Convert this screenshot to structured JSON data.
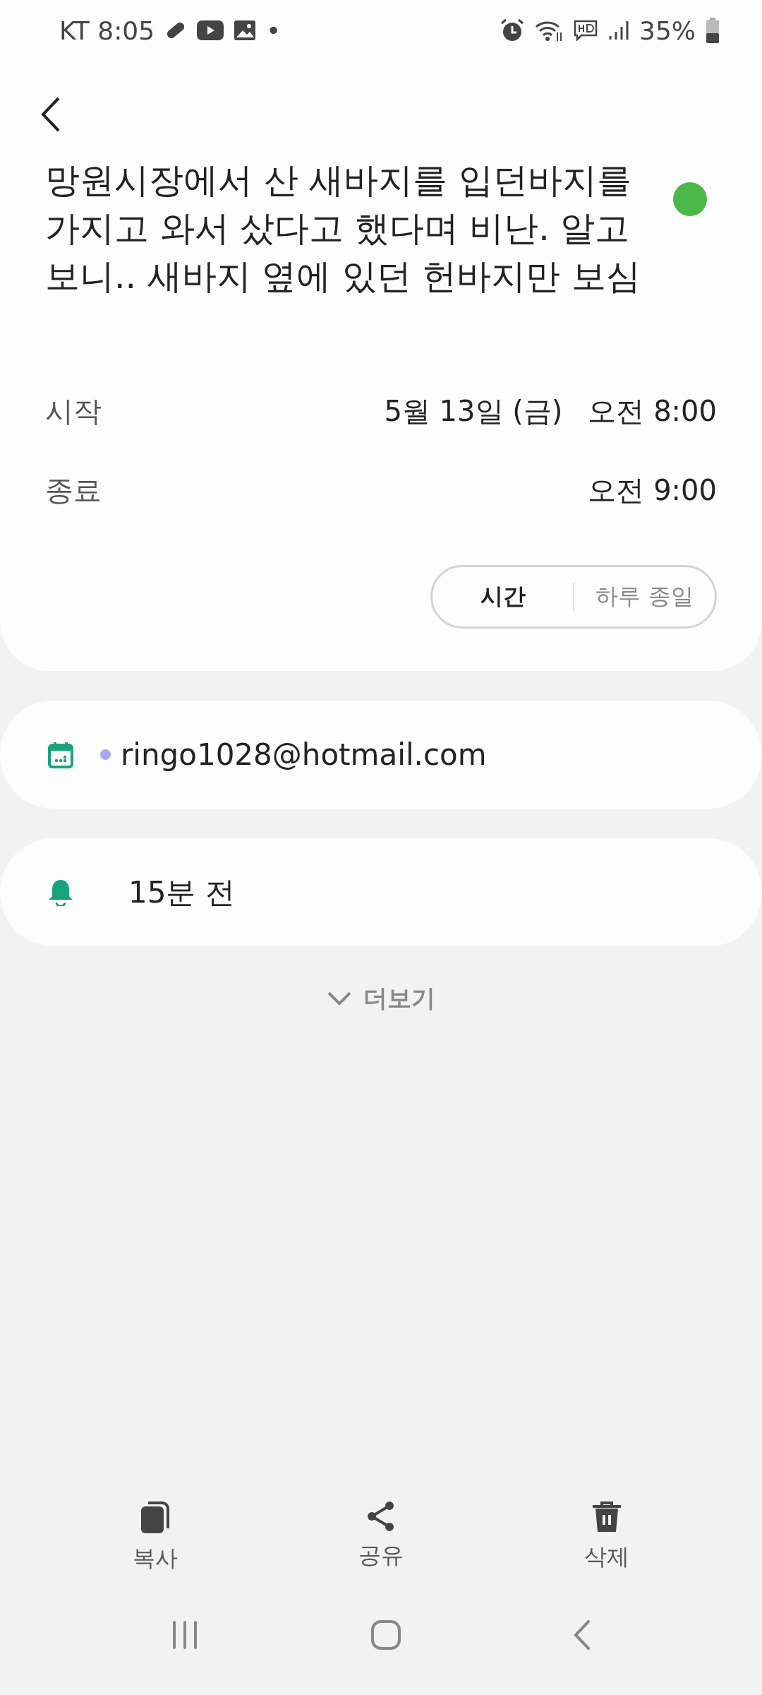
{
  "status_bar": {
    "carrier_time": "KT 8:05",
    "dot": "•",
    "battery": "35%"
  },
  "event": {
    "title": "망원시장에서 산 새바지를 입던바지를 가지고 와서 샀다고 했다며 비난. 알고 보니.. 새바지 옆에 있던 헌바지만 보심",
    "color": "#4cb84a",
    "start": {
      "label": "시작",
      "date": "5월 13일 (금)",
      "time": "오전 8:00"
    },
    "end": {
      "label": "종료",
      "time": "오전 9:00"
    },
    "time_mode": [
      {
        "label": "시간",
        "selected": true
      },
      {
        "label": "하루 종일",
        "selected": false
      }
    ]
  },
  "calendar": {
    "account": "ringo1028@hotmail.com",
    "color": "#a8a8f4"
  },
  "reminder": {
    "text": "15분 전"
  },
  "more": {
    "label": "더보기"
  },
  "actions": [
    {
      "kind": "copy",
      "label": "복사"
    },
    {
      "kind": "share",
      "label": "공유"
    },
    {
      "kind": "delete",
      "label": "삭제"
    }
  ]
}
